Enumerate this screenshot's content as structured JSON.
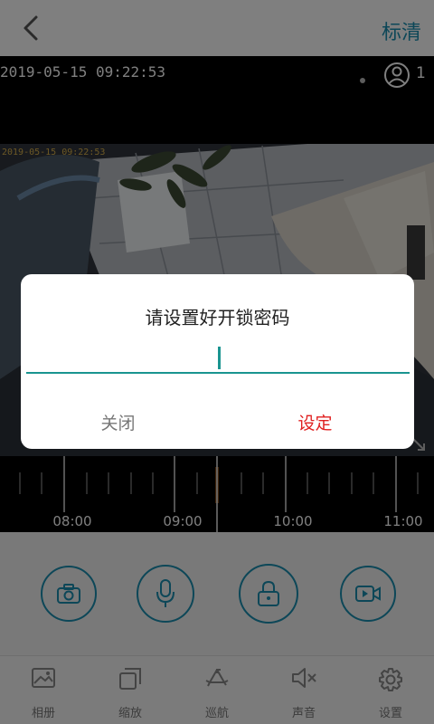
{
  "header": {
    "quality_label": "标清"
  },
  "video": {
    "timestamp": "2019-05-15 09:22:53",
    "frame_timestamp": "2019-05-15 09:22:53",
    "viewer_count": "1"
  },
  "timeline": {
    "labels": [
      "08:00",
      "09:00",
      "10:00",
      "11:00"
    ]
  },
  "controls": {
    "icons": [
      "camera-icon",
      "microphone-icon",
      "lock-icon",
      "video-record-icon"
    ]
  },
  "nav": {
    "items": [
      {
        "label": "相册",
        "icon": "album-icon"
      },
      {
        "label": "缩放",
        "icon": "zoom-icon"
      },
      {
        "label": "巡航",
        "icon": "cruise-icon"
      },
      {
        "label": "声音",
        "icon": "sound-mute-icon"
      },
      {
        "label": "设置",
        "icon": "settings-icon"
      }
    ]
  },
  "dialog": {
    "title": "请设置好开锁密码",
    "password_value": "",
    "close_label": "关闭",
    "confirm_label": "设定"
  },
  "colors": {
    "accent": "#1a8fb0",
    "input_underline": "#1a9490",
    "confirm": "#e02020"
  }
}
